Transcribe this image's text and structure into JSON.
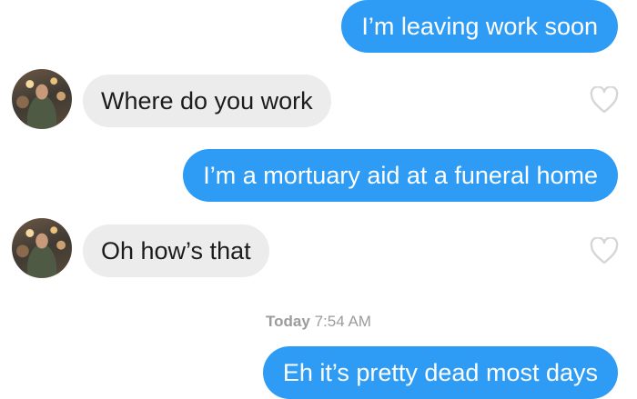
{
  "conversation": {
    "messages": [
      {
        "direction": "outgoing",
        "text": "I’m leaving work soon"
      },
      {
        "direction": "incoming",
        "text": "Where do you work",
        "liked": false
      },
      {
        "direction": "outgoing",
        "text": "I’m a mortuary aid at a funeral home"
      },
      {
        "direction": "incoming",
        "text": "Oh how’s that",
        "liked": false
      },
      {
        "direction": "outgoing",
        "text": "Eh it’s pretty dead most days"
      }
    ],
    "timestamp": {
      "day": "Today",
      "time": "7:54 AM"
    }
  },
  "colors": {
    "outgoing_bubble": "#2e9cf5",
    "incoming_bubble": "#ececec",
    "like_icon": "#d6d6d6",
    "timestamp_text": "#9b9b9b"
  },
  "icons": {
    "like": "heart-outline-icon",
    "avatar": "match-profile-photo"
  }
}
